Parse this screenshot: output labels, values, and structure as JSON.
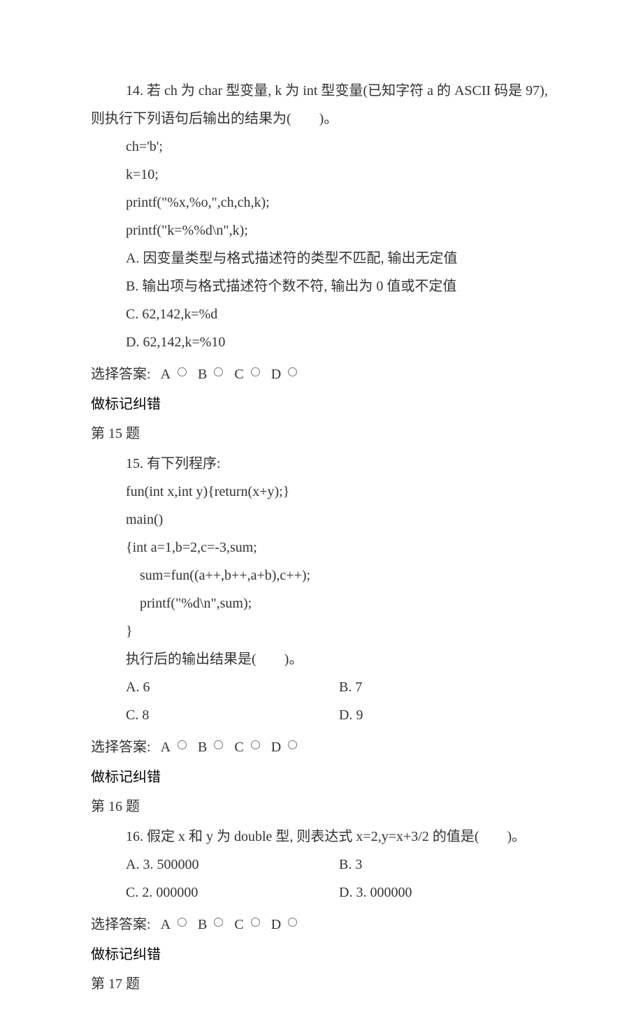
{
  "q14": {
    "intro": "14. 若 ch 为 char 型变量, k 为 int 型变量(已知字符 a 的 ASCII 码是 97), 则执行下列语句后输出的结果为(　　)。",
    "code1": "ch='b';",
    "code2": "k=10;",
    "code3": "printf(\"%x,%o,\",ch,ch,k);",
    "code4": "printf(\"k=%%d\\n\",k);",
    "optA": "A. 因变量类型与格式描述符的类型不匹配, 输出无定值",
    "optB": "B. 输出项与格式描述符个数不符, 输出为 0 值或不定值",
    "optC": "C. 62,142,k=%d",
    "optD": "D. 62,142,k=%10"
  },
  "q15": {
    "section": "第 15 题",
    "intro": "15. 有下列程序:",
    "code1": "fun(int x,int y){return(x+y);}",
    "code2": "main()",
    "code3": "{int a=1,b=2,c=-3,sum;",
    "code4": "sum=fun((a++,b++,a+b),c++);",
    "code5": "printf(\"%d\\n\",sum);",
    "code6": "}",
    "stem": "执行后的输出结果是(　　)。",
    "optA": "A. 6",
    "optB": "B. 7",
    "optC": "C. 8",
    "optD": "D. 9"
  },
  "q16": {
    "section": "第 16 题",
    "intro": "16. 假定 x 和 y 为 double 型, 则表达式 x=2,y=x+3/2 的值是(　　)。",
    "optA": "A. 3. 500000",
    "optB": "B. 3",
    "optC": "C. 2. 000000",
    "optD": "D. 3. 000000"
  },
  "q17": {
    "section": "第 17 题"
  },
  "answer": {
    "label": "选择答案:",
    "A": "A",
    "B": "B",
    "C": "C",
    "D": "D"
  },
  "mark": {
    "mark_label": "做标记",
    "correct_label": "纠错"
  }
}
